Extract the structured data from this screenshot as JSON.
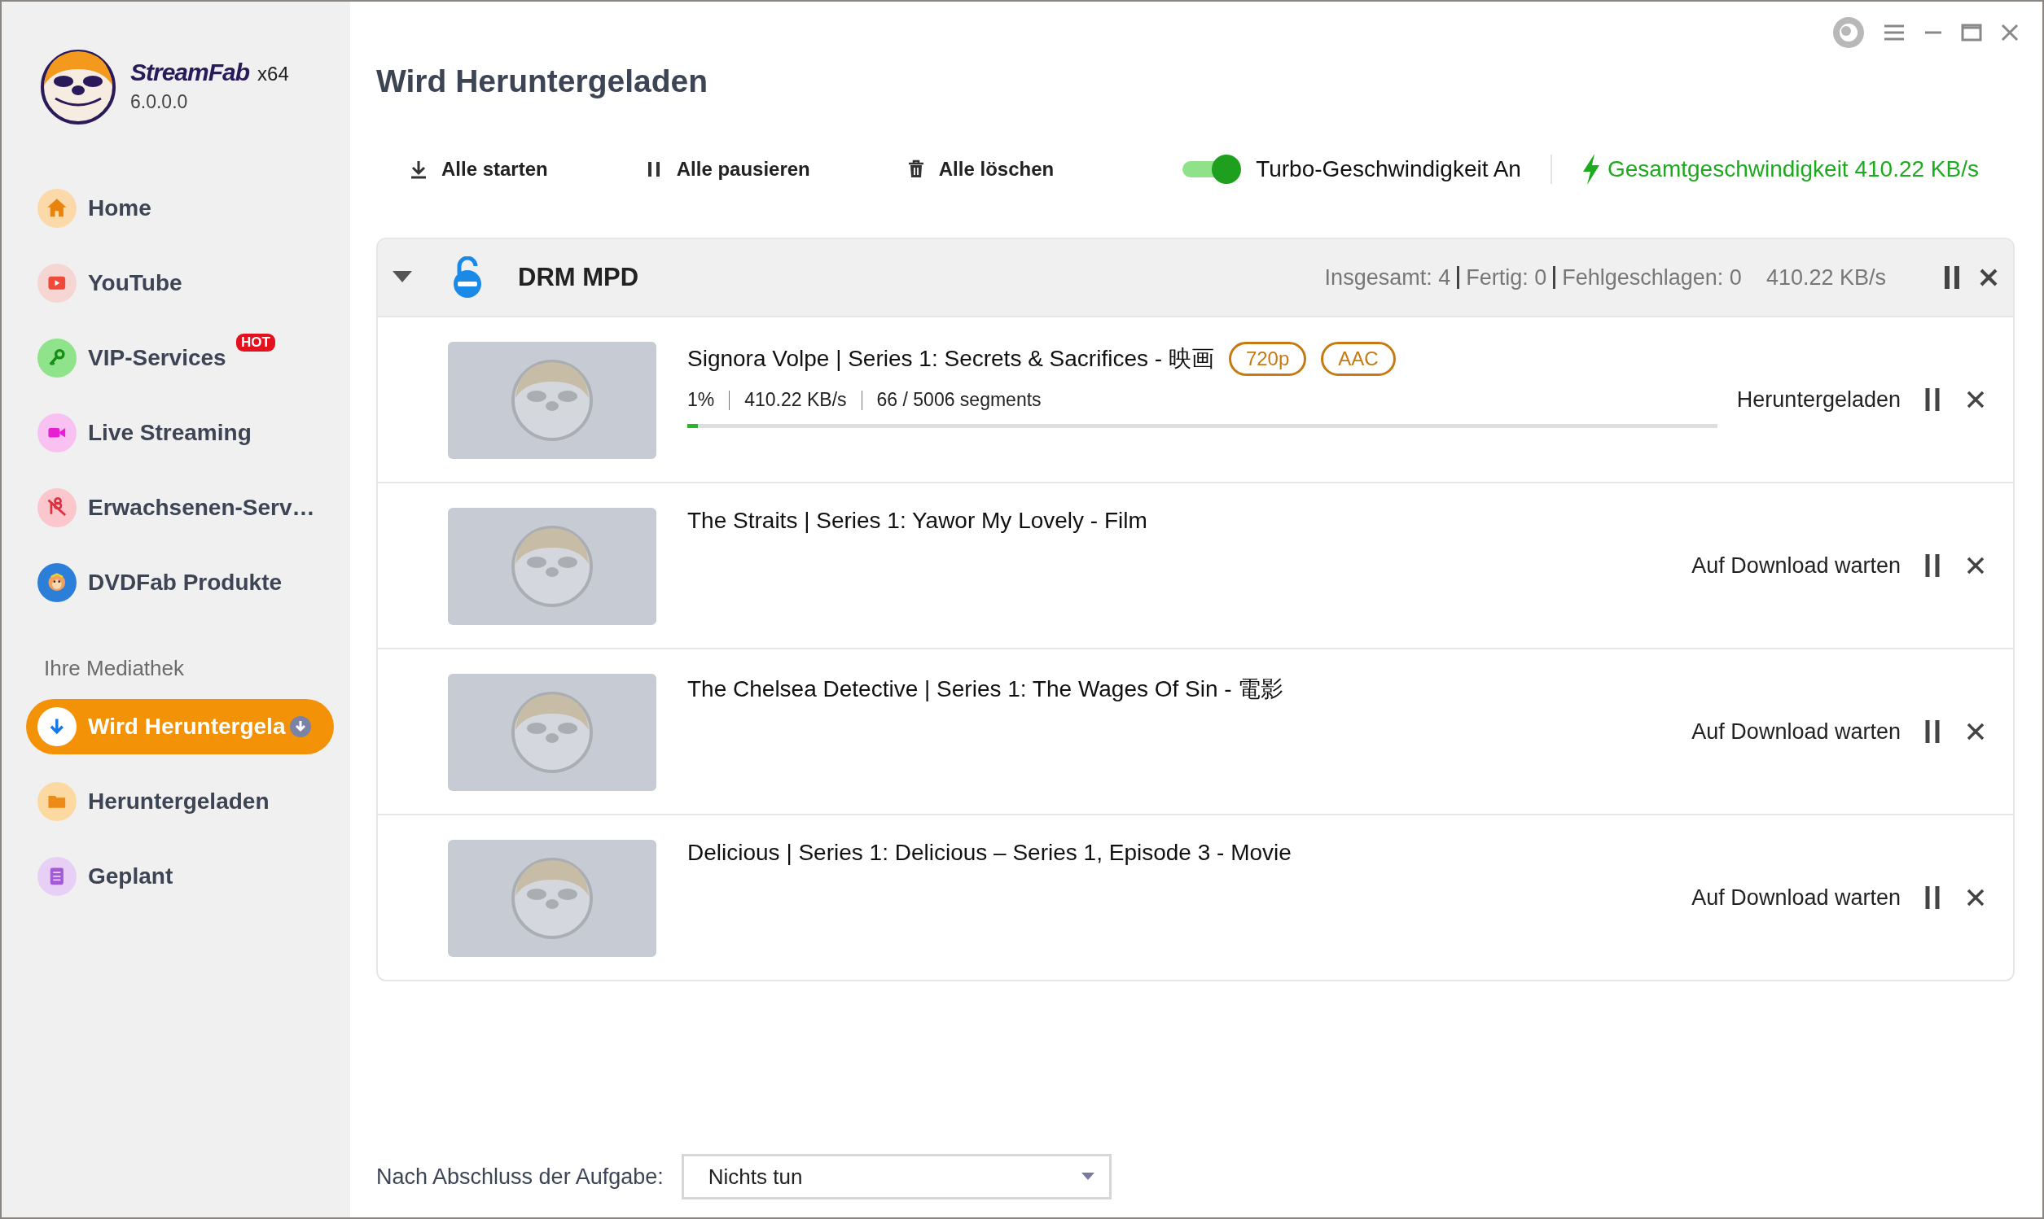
{
  "app": {
    "name": "StreamFab",
    "arch": "x64",
    "version": "6.0.0.0"
  },
  "sidebar": {
    "items": [
      {
        "kind": "home",
        "label": "Home",
        "selected": false
      },
      {
        "kind": "youtube",
        "label": "YouTube",
        "selected": false
      },
      {
        "kind": "vip",
        "label": "VIP-Services",
        "badge": "HOT",
        "selected": false
      },
      {
        "kind": "live",
        "label": "Live Streaming",
        "selected": false
      },
      {
        "kind": "adult",
        "label": "Erwachsenen-Serv…",
        "selected": false
      },
      {
        "kind": "dvdfab",
        "label": "DVDFab Produkte",
        "selected": false
      }
    ],
    "library_heading": "Ihre Mediathek",
    "library_items": [
      {
        "kind": "downloading",
        "label": "Wird Heruntergela",
        "selected": true
      },
      {
        "kind": "downloaded",
        "label": "Heruntergeladen",
        "selected": false
      },
      {
        "kind": "scheduled",
        "label": "Geplant",
        "selected": false
      }
    ]
  },
  "page_title": "Wird Heruntergeladen",
  "toolbar": {
    "buttons": [
      {
        "kind": "start",
        "label": "Alle starten"
      },
      {
        "kind": "pause",
        "label": "Alle pausieren"
      },
      {
        "kind": "delete",
        "label": "Alle löschen"
      }
    ],
    "turbo": {
      "label": "Turbo-Geschwindigkeit An",
      "on": true
    },
    "total_speed": "Gesamtgeschwindigkeit 410.22 KB/s"
  },
  "group": {
    "title": "DRM MPD",
    "expanded": true,
    "stats": [
      "Insgesamt: 4",
      "Fertig: 0",
      "Fehlgeschlagen: 0"
    ],
    "speed": "410.22 KB/s",
    "items": [
      {
        "title": "Signora Volpe | Series 1: Secrets & Sacrifices - 映画",
        "tags": [
          "720p",
          "AAC"
        ],
        "progress": {
          "percent": "1%",
          "speed": "410.22 KB/s",
          "segments": "66 / 5006 segments",
          "level": 0.01
        },
        "status": "Heruntergeladen"
      },
      {
        "title": "The Straits | Series 1: Yawor My Lovely - Film",
        "status": "Auf Download warten"
      },
      {
        "title": "The Chelsea Detective | Series 1: The Wages Of Sin - 電影",
        "status": "Auf Download warten"
      },
      {
        "title": "Delicious | Series 1: Delicious – Series 1, Episode 3 - Movie",
        "status": "Auf Download warten"
      }
    ]
  },
  "footer": {
    "label": "Nach Abschluss der Aufgabe:",
    "select_value": "Nichts tun"
  }
}
